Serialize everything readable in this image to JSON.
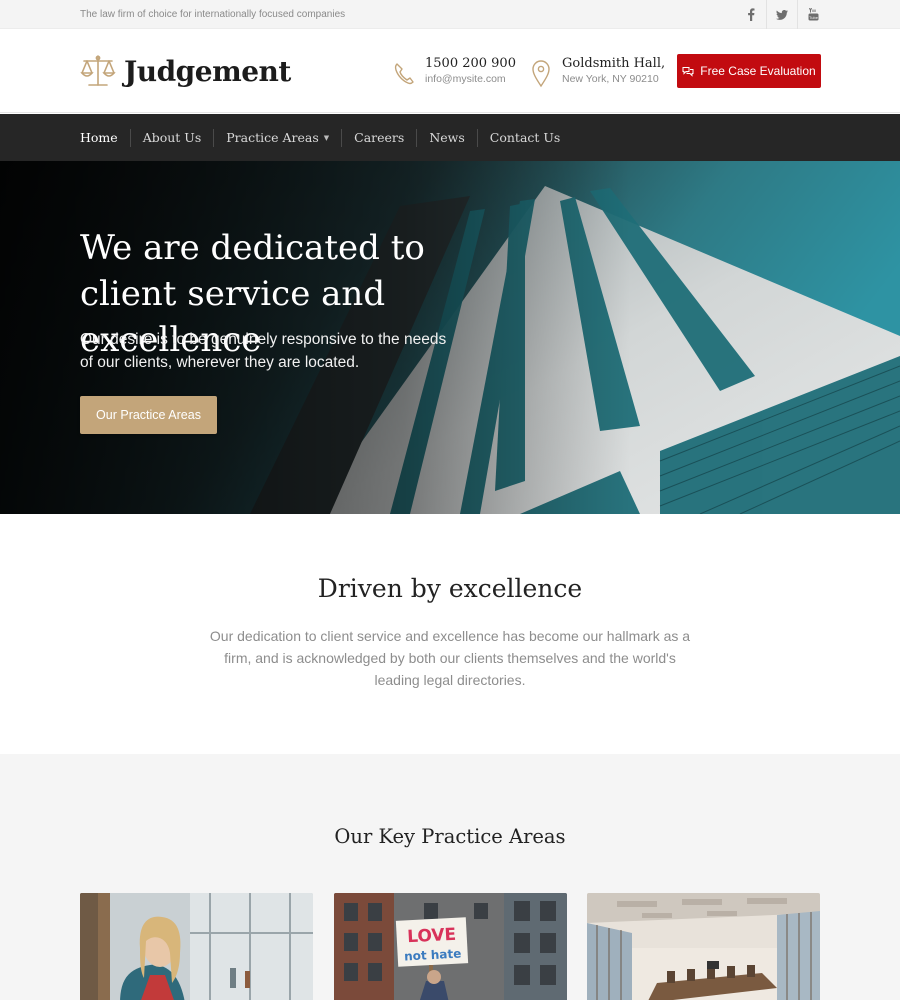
{
  "topbar": {
    "tagline": "The law firm of choice for internationally focused companies",
    "socials": [
      {
        "icon": "facebook-icon"
      },
      {
        "icon": "twitter-icon"
      },
      {
        "icon": "youtube-icon"
      }
    ]
  },
  "header": {
    "logo_text": "Judgement",
    "logo_icon": "scales-icon",
    "phone": {
      "icon": "phone-icon",
      "line1": "1500 200 900",
      "line2": "info@mysite.com"
    },
    "address": {
      "icon": "location-pin-icon",
      "line1": "Goldsmith Hall,",
      "line2": "New York, NY 90210"
    },
    "cta_label": "Free Case Evaluation",
    "cta_icon": "chat-icon"
  },
  "nav": {
    "items": [
      {
        "label": "Home"
      },
      {
        "label": "About Us"
      },
      {
        "label": "Practice Areas",
        "has_dropdown": true
      },
      {
        "label": "Careers"
      },
      {
        "label": "News"
      },
      {
        "label": "Contact Us"
      }
    ]
  },
  "hero": {
    "title": "We are dedicated to client service and excellence",
    "subtitle": "Our desire is to be genuinely responsive to the needs of our clients, wherever they are located.",
    "button_label": "Our Practice Areas"
  },
  "intro": {
    "title": "Driven by excellence",
    "text": "Our dedication to client service and excellence has become our hallmark as a firm, and is acknowledged by both our clients themselves and the world's leading legal directories."
  },
  "practice": {
    "title": "Our Key Practice Areas",
    "cards": [
      {
        "image": "woman-portrait-photo"
      },
      {
        "image": "protest-sign-photo",
        "sign_text_1": "LOVE",
        "sign_text_2": "not hate"
      },
      {
        "image": "conference-room-photo"
      }
    ]
  },
  "colors": {
    "accent_red": "#c20b10",
    "accent_gold": "#c3a57a",
    "nav_bg": "#262626"
  }
}
